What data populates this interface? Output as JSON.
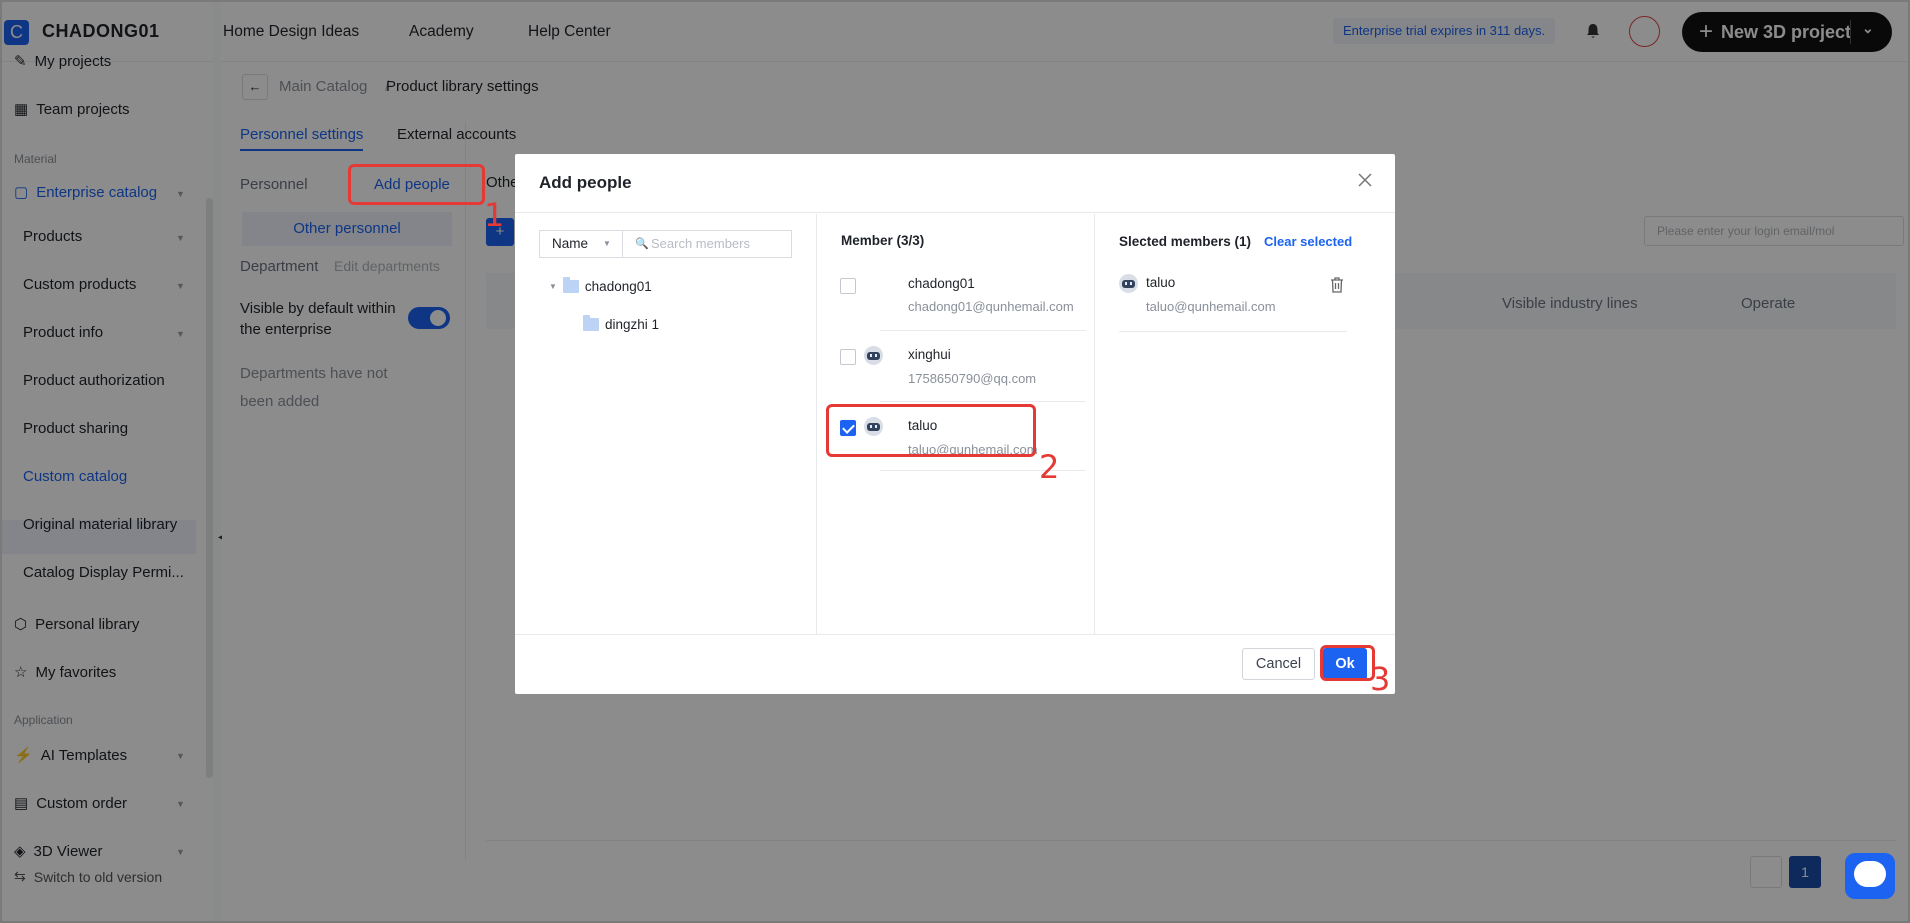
{
  "app": {
    "logo_letter": "C",
    "brand": "CHADONG01",
    "nav": [
      "Home Design Ideas",
      "Academy",
      "Help Center"
    ],
    "trial_notice": "Enterprise trial expires in 311 days.",
    "new_project_label": "New 3D project"
  },
  "sidebar": {
    "items_top": [
      "My projects",
      "Team projects"
    ],
    "section_material": "Material",
    "enterprise_catalog": "Enterprise catalog",
    "sub_items": [
      "Products",
      "Custom products",
      "Product info",
      "Product authorization",
      "Product sharing",
      "Custom catalog",
      "Original material library",
      "Catalog Display Permi..."
    ],
    "personal_library": "Personal library",
    "my_favorites": "My favorites",
    "section_application": "Application",
    "ai_templates": "AI Templates",
    "custom_order": "Custom order",
    "viewer": "3D Viewer",
    "switch_old": "Switch to old version"
  },
  "page": {
    "breadcrumb": [
      "Main Catalog",
      "Product library settings"
    ],
    "tabs": [
      "Personnel settings",
      "External accounts"
    ],
    "personnel_label": "Personnel",
    "add_people": "Add people",
    "other_tab_partial": "Othe",
    "other_personnel": "Other personnel",
    "department": "Department",
    "edit_departments": "Edit departments",
    "visible_default": "Visible by default within the enterprise",
    "departments_empty": "Departments have not been added",
    "search_placeholder": "Please enter your login email/mol",
    "col_visible_industry": "Visible industry lines",
    "col_operate": "Operate",
    "page_number": "1"
  },
  "modal": {
    "title": "Add people",
    "filter_select": "Name",
    "search_placeholder": "Search members",
    "tree": [
      "chadong01",
      "dingzhi 1"
    ],
    "member_header": "Member (3/3)",
    "members": [
      {
        "name": "chadong01",
        "email": "chadong01@qunhemail.com",
        "checked": false
      },
      {
        "name": "xinghui",
        "email": "1758650790@qq.com",
        "checked": false
      },
      {
        "name": "taluo",
        "email": "taluo@qunhemail.com",
        "checked": true
      }
    ],
    "selected_header": "Slected members (1)",
    "clear_selected": "Clear selected",
    "selected": [
      {
        "name": "taluo",
        "email": "taluo@qunhemail.com"
      }
    ],
    "cancel": "Cancel",
    "ok": "Ok"
  },
  "annotations": [
    "1",
    "2",
    "3"
  ],
  "colors": {
    "primary": "#1b63f0",
    "annotation": "#e53935"
  }
}
